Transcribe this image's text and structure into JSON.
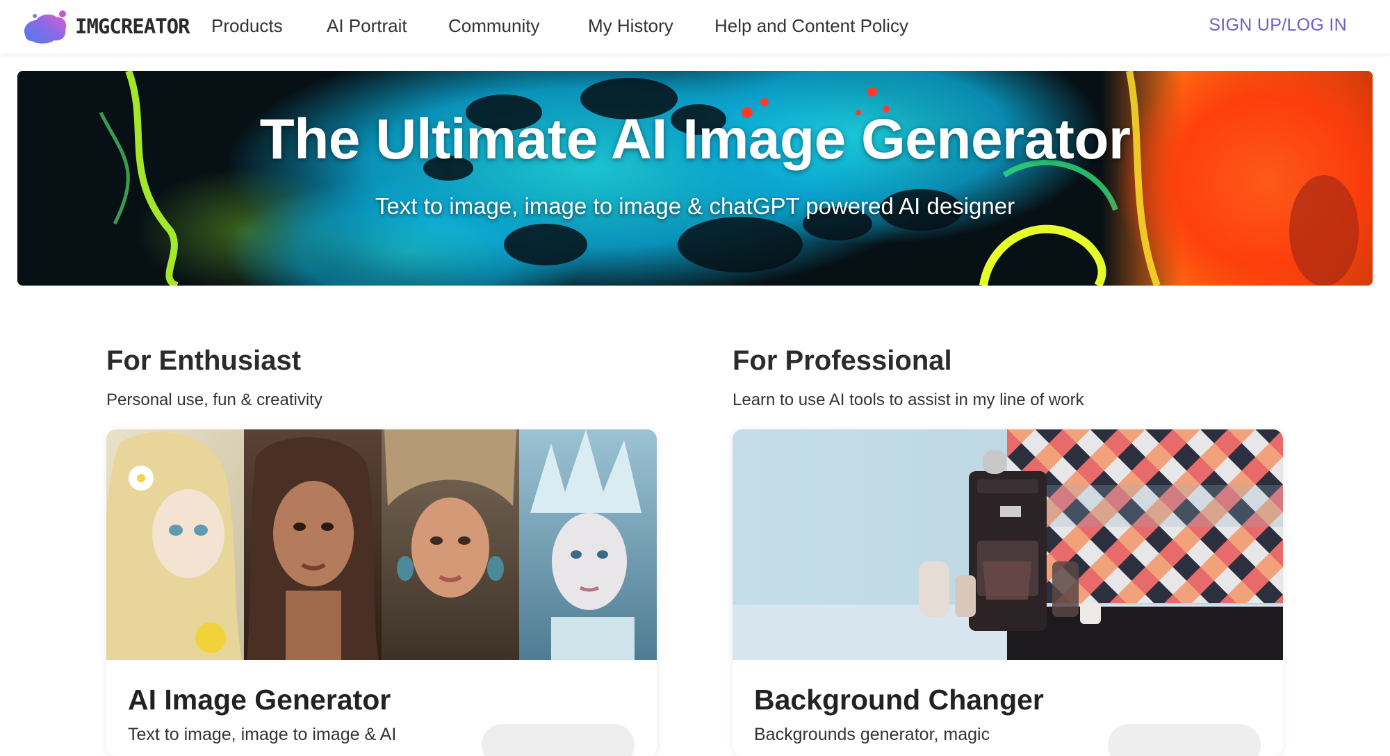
{
  "nav": {
    "logo_text": "IMGCREATOR",
    "items": [
      {
        "label": "Products"
      },
      {
        "label": "AI Portrait"
      },
      {
        "label": "Community"
      },
      {
        "label": "My History"
      },
      {
        "label": "Help and Content Policy"
      }
    ],
    "signup_label": "SIGN UP/LOG IN"
  },
  "hero": {
    "title": "The Ultimate AI Image Generator",
    "subtitle": "Text to image, image to image & chatGPT powered AI designer"
  },
  "sections": [
    {
      "title": "For Enthusiast",
      "subtitle": "Personal use, fun & creativity",
      "card": {
        "title": "AI Image Generator",
        "description": "Text to image, image to image & AI"
      }
    },
    {
      "title": "For Professional",
      "subtitle": "Learn to use AI tools to assist in my line of work",
      "card": {
        "title": "Background Changer",
        "description": "Backgrounds generator, magic"
      }
    }
  ],
  "colors": {
    "brand_purple": "#6b5fc7",
    "logo_gradient_start": "#5b7cf0",
    "logo_gradient_end": "#d25fd8",
    "text_dark": "#2b2b2b"
  },
  "icons": {
    "logo": "imgcreator-blob-logo"
  }
}
